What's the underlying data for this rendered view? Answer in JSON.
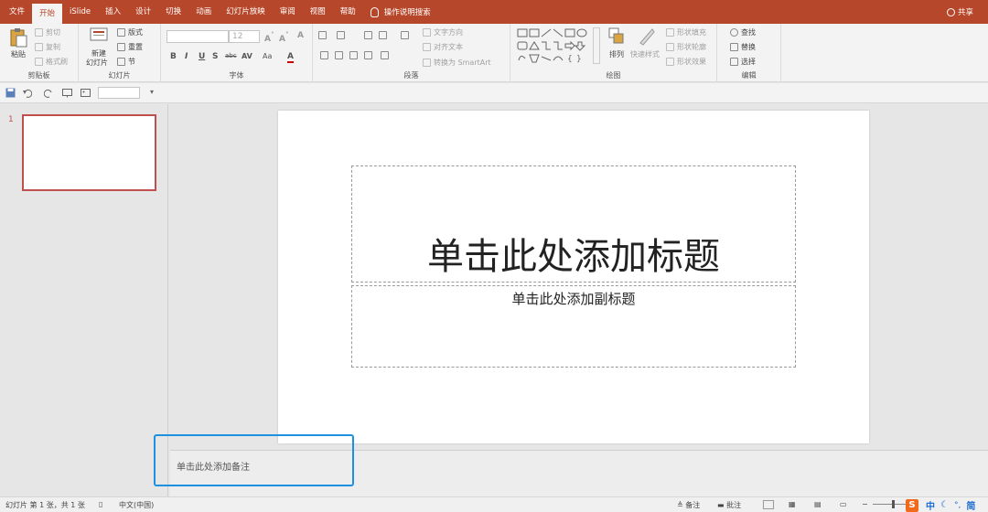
{
  "tabs": [
    "文件",
    "开始",
    "iSlide",
    "插入",
    "设计",
    "切换",
    "动画",
    "幻灯片放映",
    "审阅",
    "视图",
    "帮助"
  ],
  "active_tab": "开始",
  "tell_me": "操作说明搜索",
  "share": "共享",
  "ribbon": {
    "clipboard": {
      "paste": "粘贴",
      "cut": "剪切",
      "copy": "复制",
      "format_painter": "格式刷",
      "label": "剪贴板"
    },
    "slides": {
      "new_slide_1": "新建",
      "new_slide_2": "幻灯片",
      "layout": "版式",
      "reset": "重置",
      "section": "节",
      "label": "幻灯片"
    },
    "font": {
      "size": "12",
      "label": "字体",
      "bold": "B",
      "italic": "I",
      "underline": "U",
      "shadow": "S",
      "strike": "abc",
      "spacing": "AV",
      "case": "Aa",
      "color": "A"
    },
    "paragraph": {
      "text_direction": "文字方向",
      "align_text": "对齐文本",
      "smartart": "转换为 SmartArt",
      "label": "段落"
    },
    "drawing": {
      "arrange": "排列",
      "quick_styles": "快速样式",
      "shape_fill": "形状填充",
      "shape_outline": "形状轮廓",
      "shape_effects": "形状效果",
      "label": "绘图"
    },
    "editing": {
      "find": "查找",
      "replace": "替换",
      "select": "选择",
      "label": "编辑"
    }
  },
  "thumbnail": {
    "number": "1"
  },
  "slide": {
    "title_placeholder": "单击此处添加标题",
    "subtitle_placeholder": "单击此处添加副标题"
  },
  "notes": {
    "placeholder": "单击此处添加备注"
  },
  "status": {
    "slide_info": "幻灯片 第 1 张，共 1 张",
    "language": "中文(中国)",
    "notes_btn": "备注",
    "comments_btn": "批注",
    "ime_s": "S",
    "ime_lang": "中",
    "ime_mode": "简"
  },
  "colors": {
    "accent": "#b7472a",
    "selection": "#1e90e0",
    "thumb_border": "#c0504d"
  }
}
